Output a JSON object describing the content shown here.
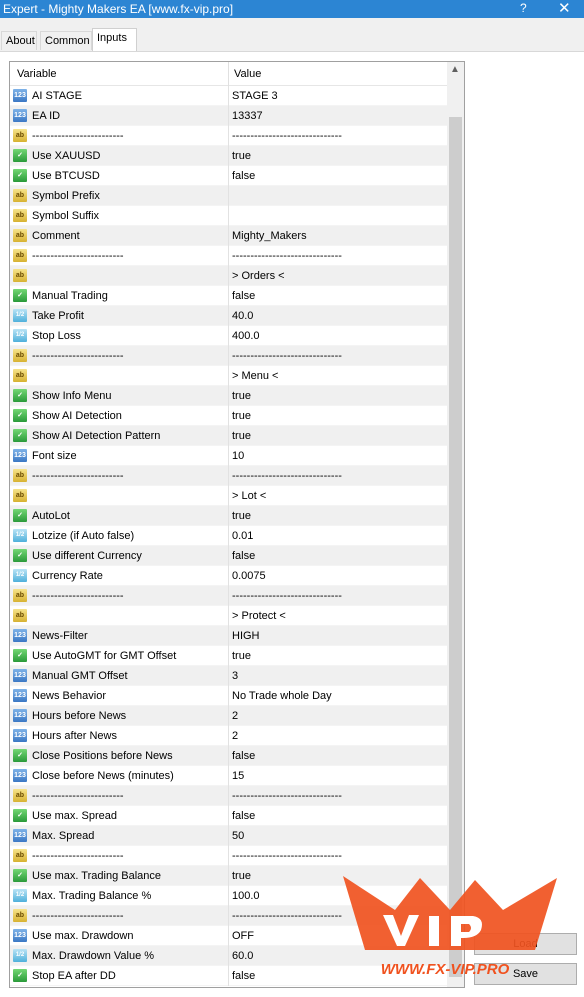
{
  "window": {
    "title": "Expert - Mighty Makers EA [www.fx-vip.pro]",
    "help_label": "?",
    "close_label": "✕"
  },
  "tabs": [
    {
      "label": "About",
      "active": false
    },
    {
      "label": "Common",
      "active": false
    },
    {
      "label": "Inputs",
      "active": true
    }
  ],
  "grid": {
    "columns": {
      "variable": "Variable",
      "value": "Value"
    },
    "rows": [
      {
        "type": "num",
        "name": "AI STAGE",
        "value": "STAGE 3"
      },
      {
        "type": "num",
        "name": "EA ID",
        "value": "13337"
      },
      {
        "type": "str",
        "name": "-------------------------",
        "value": "------------------------------"
      },
      {
        "type": "bool",
        "name": "Use XAUUSD",
        "value": "true"
      },
      {
        "type": "bool",
        "name": "Use BTCUSD",
        "value": "false"
      },
      {
        "type": "str",
        "name": "Symbol Prefix",
        "value": ""
      },
      {
        "type": "str",
        "name": "Symbol Suffix",
        "value": ""
      },
      {
        "type": "str",
        "name": "Comment",
        "value": "Mighty_Makers"
      },
      {
        "type": "str",
        "name": "-------------------------",
        "value": "------------------------------"
      },
      {
        "type": "str",
        "name": "",
        "value": " > Orders <"
      },
      {
        "type": "bool",
        "name": "Manual Trading",
        "value": "false"
      },
      {
        "type": "flt",
        "name": "Take Profit",
        "value": "40.0"
      },
      {
        "type": "flt",
        "name": "Stop Loss",
        "value": "400.0"
      },
      {
        "type": "str",
        "name": "-------------------------",
        "value": "------------------------------"
      },
      {
        "type": "str",
        "name": "",
        "value": " > Menu <"
      },
      {
        "type": "bool",
        "name": "Show Info Menu",
        "value": "true"
      },
      {
        "type": "bool",
        "name": "Show AI Detection",
        "value": "true"
      },
      {
        "type": "bool",
        "name": "Show AI Detection Pattern",
        "value": "true"
      },
      {
        "type": "num",
        "name": "Font size",
        "value": "10"
      },
      {
        "type": "str",
        "name": "-------------------------",
        "value": "------------------------------"
      },
      {
        "type": "str",
        "name": "",
        "value": " > Lot <"
      },
      {
        "type": "bool",
        "name": "AutoLot",
        "value": "true"
      },
      {
        "type": "flt",
        "name": "Lotzize (if Auto false)",
        "value": "0.01"
      },
      {
        "type": "bool",
        "name": "Use different Currency",
        "value": "false"
      },
      {
        "type": "flt",
        "name": "Currency Rate",
        "value": "0.0075"
      },
      {
        "type": "str",
        "name": "-------------------------",
        "value": "------------------------------"
      },
      {
        "type": "str",
        "name": "",
        "value": " > Protect <"
      },
      {
        "type": "num",
        "name": "News-Filter",
        "value": "HIGH"
      },
      {
        "type": "bool",
        "name": "Use AutoGMT for GMT Offset",
        "value": "true"
      },
      {
        "type": "num",
        "name": "Manual GMT Offset",
        "value": "3"
      },
      {
        "type": "num",
        "name": "News Behavior",
        "value": "No Trade whole Day"
      },
      {
        "type": "num",
        "name": "Hours before News",
        "value": "2"
      },
      {
        "type": "num",
        "name": "Hours after News",
        "value": "2"
      },
      {
        "type": "bool",
        "name": "Close Positions before News",
        "value": "false"
      },
      {
        "type": "num",
        "name": "Close before News (minutes)",
        "value": "15"
      },
      {
        "type": "str",
        "name": "-------------------------",
        "value": "------------------------------"
      },
      {
        "type": "bool",
        "name": "Use max. Spread",
        "value": "false"
      },
      {
        "type": "num",
        "name": "Max. Spread",
        "value": "50"
      },
      {
        "type": "str",
        "name": "-------------------------",
        "value": "------------------------------"
      },
      {
        "type": "bool",
        "name": "Use max. Trading Balance",
        "value": "true"
      },
      {
        "type": "flt",
        "name": "Max. Trading Balance %",
        "value": "100.0"
      },
      {
        "type": "str",
        "name": "-------------------------",
        "value": "------------------------------"
      },
      {
        "type": "num",
        "name": "Use max. Drawdown",
        "value": "OFF"
      },
      {
        "type": "flt",
        "name": "Max. Drawdown Value %",
        "value": "60.0"
      },
      {
        "type": "bool",
        "name": "Stop EA after DD",
        "value": "false"
      }
    ]
  },
  "icons": {
    "num": "123",
    "flt": "1/2",
    "str": "ab",
    "bool": "check"
  },
  "icon_names": {
    "num": "integer-icon",
    "flt": "double-icon",
    "str": "string-icon",
    "bool": "bool-icon"
  },
  "buttons": {
    "load": "Load",
    "save": "Save"
  },
  "watermark": {
    "text": "WWW.FX-VIP.PRO"
  },
  "colors": {
    "titlebar": "#2c85d3",
    "watermark": "#f0521f"
  }
}
